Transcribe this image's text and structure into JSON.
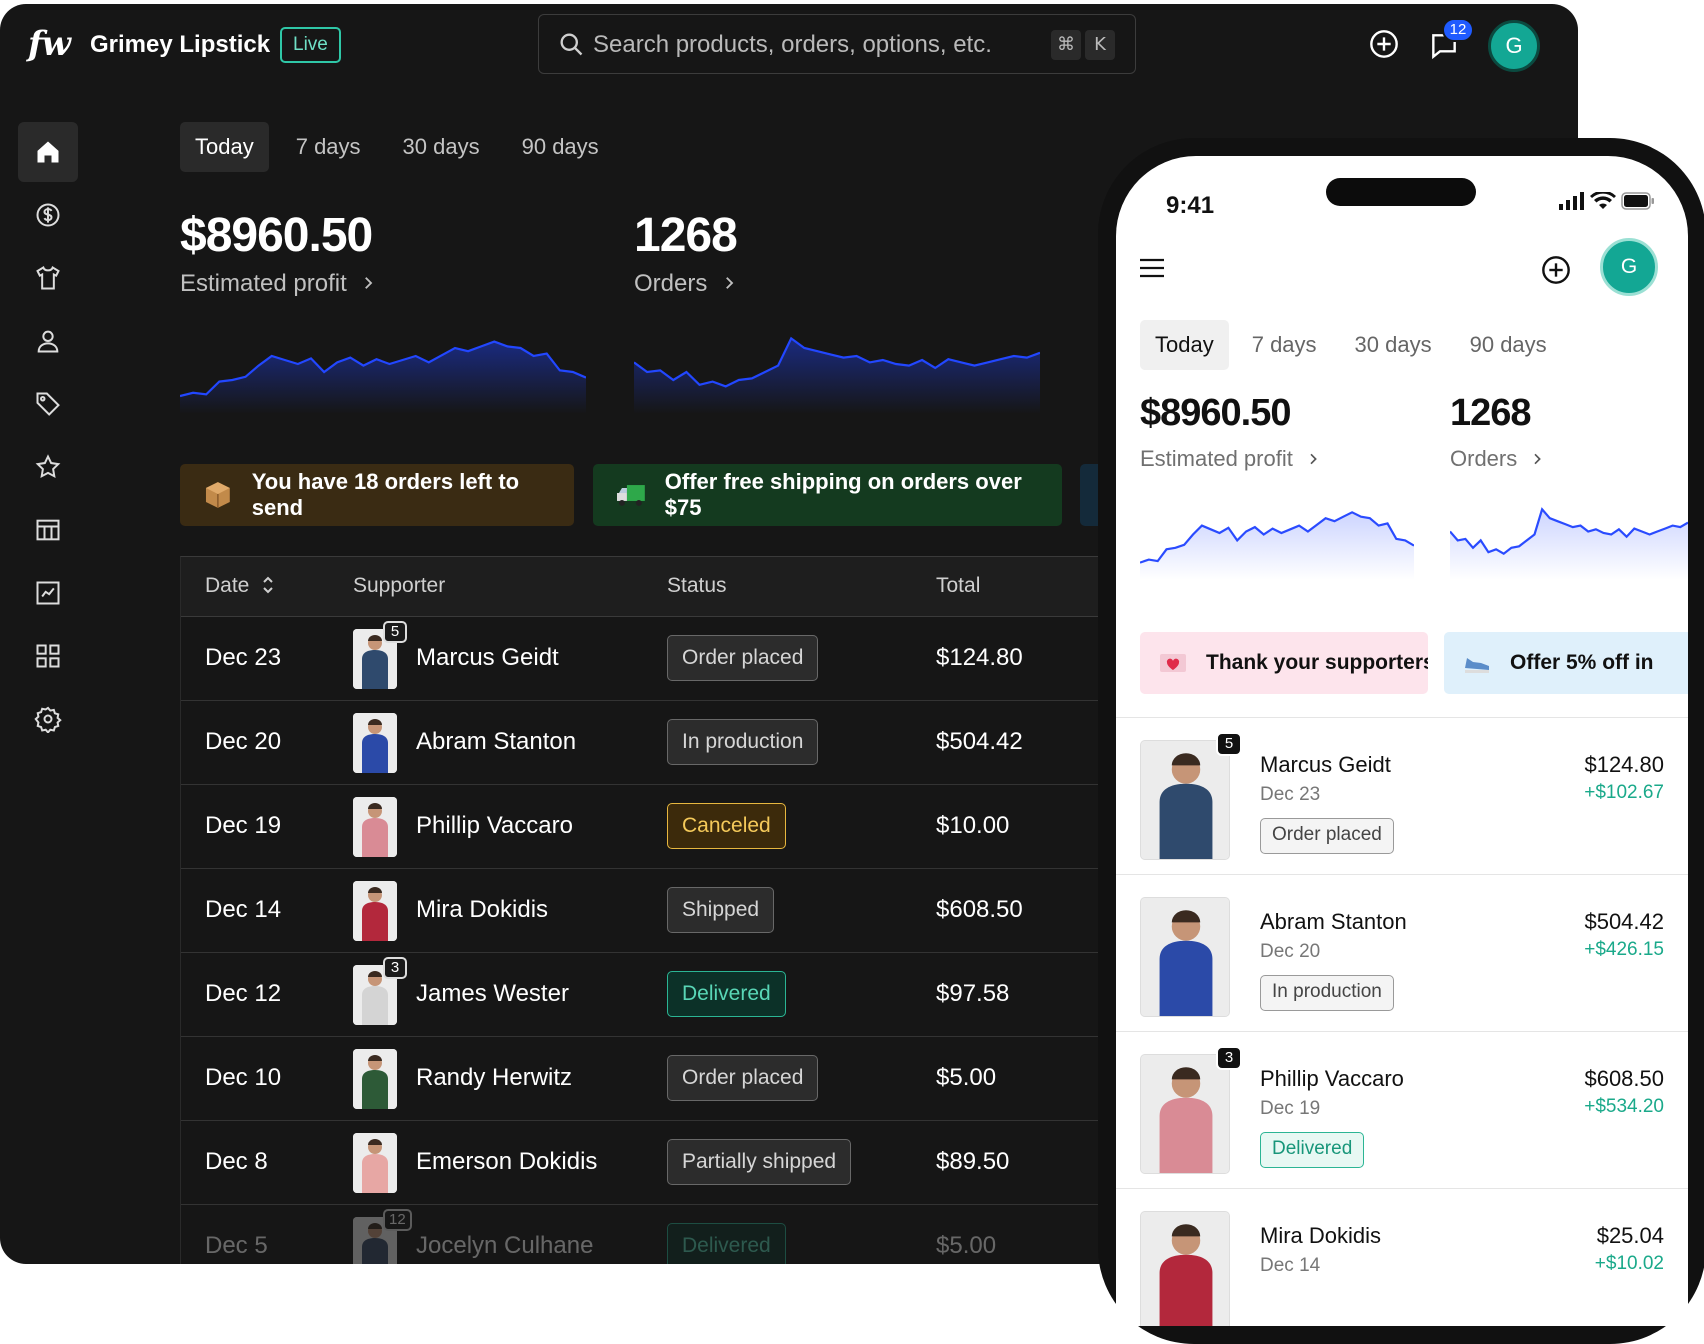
{
  "app": {
    "logo": "fw",
    "store_name": "Grimey Lipstick",
    "live_label": "Live",
    "search_placeholder": "Search products, orders, options, etc.",
    "shortcut_key_1": "⌘",
    "shortcut_key_2": "K",
    "notification_count": "12",
    "avatar_initial": "G"
  },
  "sidebar": {
    "items": [
      {
        "name": "home",
        "icon": "home-icon",
        "active": true
      },
      {
        "name": "earnings",
        "icon": "dollar-icon"
      },
      {
        "name": "products",
        "icon": "tshirt-icon"
      },
      {
        "name": "supporters",
        "icon": "user-icon"
      },
      {
        "name": "discounts",
        "icon": "tag-icon"
      },
      {
        "name": "reviews",
        "icon": "star-icon"
      },
      {
        "name": "storefront",
        "icon": "layout-icon"
      },
      {
        "name": "analytics",
        "icon": "chart-icon"
      },
      {
        "name": "apps",
        "icon": "grid-icon"
      },
      {
        "name": "settings",
        "icon": "gear-icon"
      }
    ]
  },
  "ranges": [
    "Today",
    "7 days",
    "30 days",
    "90 days"
  ],
  "metrics": {
    "profit_value": "$8960.50",
    "profit_label": "Estimated profit",
    "orders_value": "1268",
    "orders_label": "Orders"
  },
  "promos": {
    "orders_left": "You have 18 orders left to send",
    "free_shipping": "Offer free shipping on orders over $75",
    "thank_supporters": "Thank your supporters",
    "offer_discount": "Offer 5% off in"
  },
  "table": {
    "headers": {
      "date": "Date",
      "supporter": "Supporter",
      "status": "Status",
      "total": "Total"
    },
    "rows": [
      {
        "date": "Dec 23",
        "name": "Marcus Geidt",
        "count": "5",
        "status": "Order placed",
        "status_type": "default",
        "total": "$124.80",
        "shirt": "#2f4a6d"
      },
      {
        "date": "Dec 20",
        "name": "Abram Stanton",
        "count": "",
        "status": "In production",
        "status_type": "default",
        "total": "$504.42",
        "shirt": "#2b4aa8"
      },
      {
        "date": "Dec 19",
        "name": "Phillip Vaccaro",
        "count": "",
        "status": "Canceled",
        "status_type": "canceled",
        "total": "$10.00",
        "shirt": "#d98b95"
      },
      {
        "date": "Dec 14",
        "name": "Mira Dokidis",
        "count": "",
        "status": "Shipped",
        "status_type": "default",
        "total": "$608.50",
        "shirt": "#b3283c"
      },
      {
        "date": "Dec 12",
        "name": "James Wester",
        "count": "3",
        "status": "Delivered",
        "status_type": "delivered",
        "total": "$97.58",
        "shirt": "#d4d4d4"
      },
      {
        "date": "Dec 10",
        "name": "Randy Herwitz",
        "count": "",
        "status": "Order placed",
        "status_type": "default",
        "total": "$5.00",
        "shirt": "#2d5a37"
      },
      {
        "date": "Dec 8",
        "name": "Emerson Dokidis",
        "count": "",
        "status": "Partially shipped",
        "status_type": "default",
        "total": "$89.50",
        "shirt": "#e7a7a4"
      },
      {
        "date": "Dec 5",
        "name": "Jocelyn Culhane",
        "count": "12",
        "status": "Delivered",
        "status_type": "delivered",
        "total": "$5.00",
        "shirt": "#3a4a66"
      }
    ]
  },
  "phone": {
    "time": "9:41",
    "orders": [
      {
        "name": "Marcus Geidt",
        "date": "Dec 23",
        "count": "5",
        "status": "Order placed",
        "status_type": "default",
        "total": "$124.80",
        "profit": "+$102.67",
        "shirt": "#2f4a6d"
      },
      {
        "name": "Abram Stanton",
        "date": "Dec 20",
        "count": "",
        "status": "In production",
        "status_type": "default",
        "total": "$504.42",
        "profit": "+$426.15",
        "shirt": "#2b4aa8"
      },
      {
        "name": "Phillip Vaccaro",
        "date": "Dec 19",
        "count": "3",
        "status": "Delivered",
        "status_type": "delivered",
        "total": "$608.50",
        "profit": "+$534.20",
        "shirt": "#d98b95"
      },
      {
        "name": "Mira Dokidis",
        "date": "Dec 14",
        "count": "",
        "status": "",
        "status_type": "default",
        "total": "$25.04",
        "profit": "+$10.02",
        "shirt": "#b3283c"
      }
    ]
  },
  "charts": {
    "profit_trend": [
      0.1,
      0.14,
      0.12,
      0.28,
      0.3,
      0.34,
      0.48,
      0.6,
      0.55,
      0.5,
      0.57,
      0.4,
      0.52,
      0.58,
      0.48,
      0.56,
      0.5,
      0.55,
      0.6,
      0.52,
      0.61,
      0.7,
      0.66,
      0.72,
      0.78,
      0.72,
      0.7,
      0.6,
      0.63,
      0.42,
      0.4,
      0.33
    ],
    "orders_trend": [
      0.52,
      0.4,
      0.42,
      0.3,
      0.4,
      0.24,
      0.28,
      0.22,
      0.3,
      0.32,
      0.4,
      0.48,
      0.82,
      0.7,
      0.66,
      0.62,
      0.58,
      0.6,
      0.52,
      0.55,
      0.5,
      0.48,
      0.55,
      0.45,
      0.56,
      0.52,
      0.48,
      0.52,
      0.56,
      0.6,
      0.58,
      0.64
    ]
  },
  "colors": {
    "accent_blue": "#1f4bff",
    "live_green": "#2fc7a7",
    "canceled_amber": "#e7b73f",
    "delivered_teal": "#2bb594",
    "profit_green": "#1aa98a",
    "promo_amber": "#3a2b13",
    "promo_green": "#143a1f",
    "promo_pink": "#fde4ec",
    "promo_blue": "#dff0fb"
  }
}
